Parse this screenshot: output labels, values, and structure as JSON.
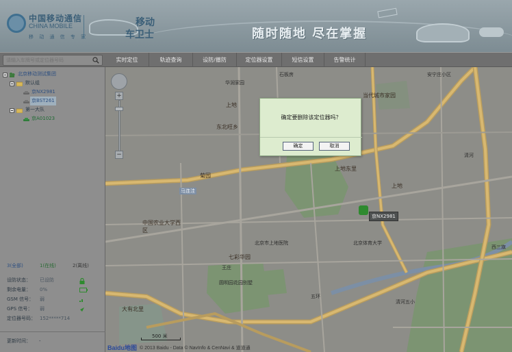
{
  "header": {
    "brand_cn": "中国移动通信",
    "brand_en": "CHINA MOBILE",
    "brand_slogan": "移 动 通 信 专 家",
    "product_line1": "移动",
    "product_line2": "车卫士",
    "slogan": "随时随地 尽在掌握"
  },
  "toolbar": {
    "search_placeholder": "请输入车牌号或定位器号码",
    "tabs": [
      "实时定位",
      "轨迹查询",
      "设防/撤防",
      "定位器设置",
      "短信设置",
      "告警统计"
    ]
  },
  "sidebar": {
    "tree": {
      "root": "北京移动测试集团",
      "group1": "默认组",
      "item1": "京NX2981",
      "item2": "京BST261",
      "group2": "第一大队",
      "item3": "京A01023"
    },
    "stats": {
      "all": "3(全部)",
      "online": "1(在线)",
      "offline": "2(离线)"
    },
    "info": [
      {
        "key": "设防状态：",
        "value": "已设防"
      },
      {
        "key": "剩余电量：",
        "value": "0%"
      },
      {
        "key": "GSM 信号：",
        "value": "弱"
      },
      {
        "key": "GPS 信号：",
        "value": "弱"
      },
      {
        "key": "定位器号码：",
        "value": "152*****714"
      }
    ],
    "update_key": "更新时间：",
    "update_value": "-"
  },
  "map": {
    "labels": [
      "安宁庄小区",
      "石板房",
      "华润家园",
      "当代城市家园",
      "上地",
      "东北旺乡",
      "上地东里",
      "菊园",
      "马连洼",
      "中国农业大学西区",
      "北京市上地医院",
      "七彩华园",
      "王庄",
      "圆明园花园别墅",
      "大有北里",
      "上地",
      "清河",
      "北京体育大学",
      "西三旗",
      "五环",
      "清河五小"
    ],
    "marker_label": "京NX2981",
    "scale_label": "500 米",
    "baidu_logo": "Baidu地图",
    "copyright": "© 2013 Baidu - Data © NavInfo & CenNavi & 道道通"
  },
  "dialog": {
    "message": "确定要删除该定位器吗？",
    "ok_label": "确定",
    "cancel_label": "取消"
  }
}
